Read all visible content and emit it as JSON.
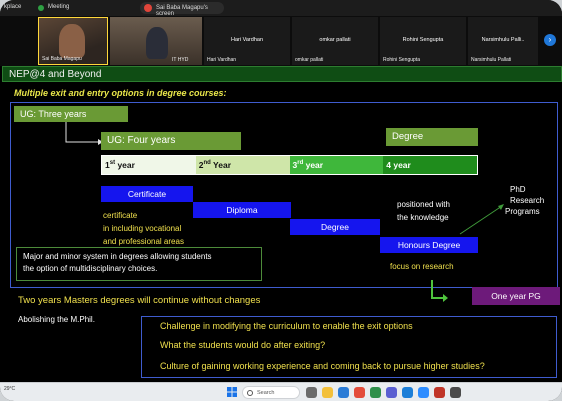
{
  "meeting": {
    "workspace_label": "kplace",
    "meeting_label": "Meeting",
    "share_label": "Sai Baba Magapu's screen"
  },
  "participants": [
    {
      "name": "Sai Baba Magapu",
      "has_video": true
    },
    {
      "name": "IT HYD",
      "has_video": true
    },
    {
      "name": "Hari Vardhan",
      "has_video": false
    },
    {
      "name": "omkar pallati",
      "has_video": false
    },
    {
      "name": "Rohini Sengupta",
      "has_video": false
    },
    {
      "name": "Narsimhulu Palli..",
      "short_name": "Narsimhulu Pallati",
      "has_video": false
    }
  ],
  "slide": {
    "title": "NEP@4 and Beyond",
    "subtitle": "Multiple exit and entry options in degree courses:",
    "ug_three": "UG: Three years",
    "ug_four": "UG: Four years",
    "degree_box": "Degree",
    "years": [
      {
        "num": "1",
        "sup": "st",
        "rest": " year"
      },
      {
        "num": "2",
        "sup": "nd",
        "rest": " Year"
      },
      {
        "num": "3",
        "sup": "rd",
        "rest": " year"
      },
      {
        "num": "4",
        "sup": "",
        "rest": " year"
      }
    ],
    "certificate": "Certificate",
    "diploma": "Diploma",
    "degree": "Degree",
    "honours": "Honours Degree",
    "certificate_note_1": "certificate",
    "certificate_note_2": "in including vocational",
    "certificate_note_3": "and professional areas",
    "positioned_1": "positioned with",
    "positioned_2": "the knowledge",
    "phd_1": "PhD",
    "phd_2": "Research",
    "phd_3": "Programs",
    "focus": "focus on research",
    "major_minor_1": "Major and minor system in degrees allowing students",
    "major_minor_2": "the option of multidisciplinary choices.",
    "masters": "Two years Masters degrees will continue without changes",
    "one_year_pg": "One year PG",
    "mphil": "Abolishing the M.Phil.",
    "challenge_1": "Challenge in modifying the curriculum to enable the exit options",
    "challenge_2": "What the students would do after exiting?",
    "challenge_3": "Culture of gaining working experience and coming back to pursue higher studies?"
  },
  "taskbar": {
    "weather": "29°C",
    "search_placeholder": "Search"
  },
  "colors": {
    "title_green": "#0f4d14",
    "box_green": "#6a9a35",
    "step_blue": "#1515ee",
    "accent_yellow": "#f0e04d",
    "pg_purple": "#6d1a7a"
  }
}
